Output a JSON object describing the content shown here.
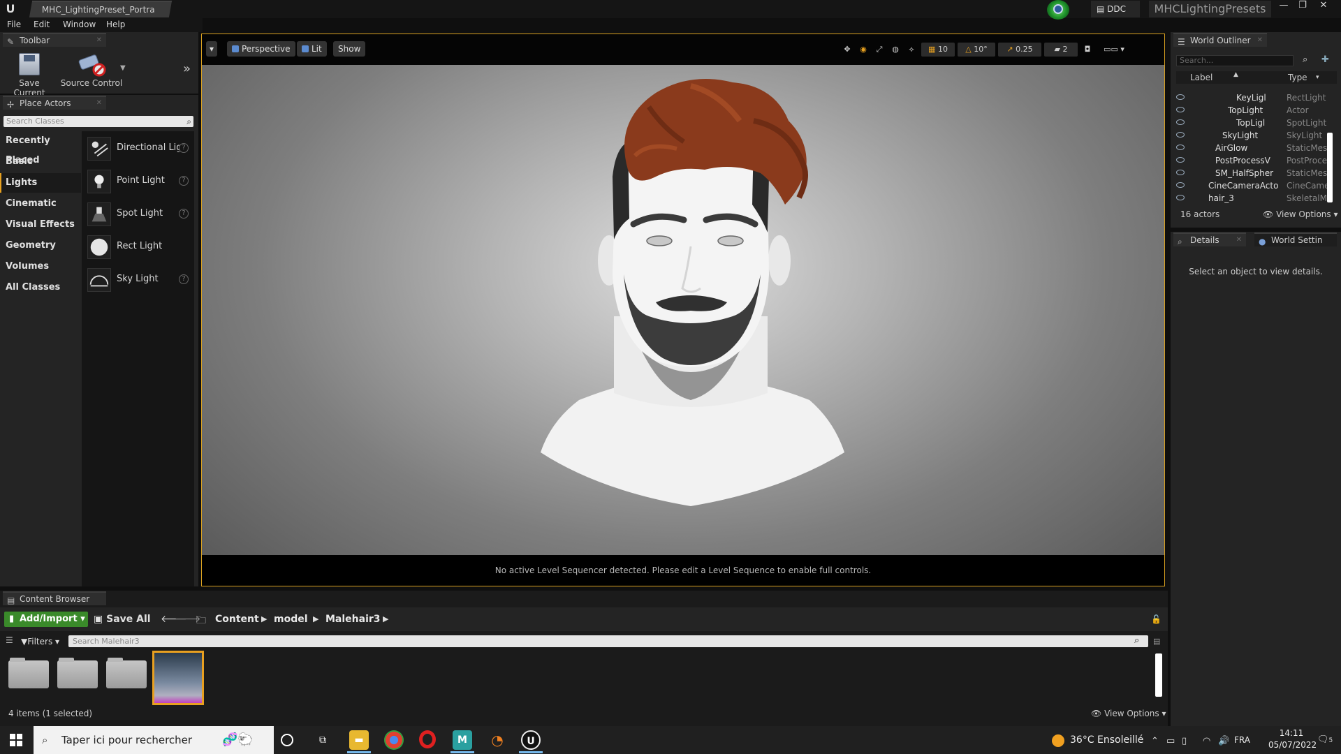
{
  "window": {
    "doc_tab": "MHC_LightingPreset_Portra",
    "ddc": "DDC",
    "project_name": "MHCLightingPresets"
  },
  "menu": [
    "File",
    "Edit",
    "Window",
    "Help"
  ],
  "toolbar": {
    "tab": "Toolbar",
    "save_current": "Save Current",
    "source_control": "Source Control"
  },
  "place_actors": {
    "tab": "Place Actors",
    "search_placeholder": "Search Classes",
    "categories": [
      "Recently Placed",
      "Basic",
      "Lights",
      "Cinematic",
      "Visual Effects",
      "Geometry",
      "Volumes",
      "All Classes"
    ],
    "selected_category": "Lights",
    "items": [
      "Directional Light",
      "Point Light",
      "Spot Light",
      "Rect Light",
      "Sky Light"
    ]
  },
  "viewport": {
    "perspective": "Perspective",
    "lit": "Lit",
    "show": "Show",
    "grid_snap": "10",
    "rotation_snap": "10°",
    "scale_snap": "0.25",
    "camera_speed": "2",
    "sequencer_message": "No active Level Sequencer detected. Please edit a Level Sequence to enable full controls."
  },
  "world_outliner": {
    "tab": "World Outliner",
    "search_placeholder": "Search...",
    "col_label": "Label",
    "col_type": "Type",
    "rows": [
      {
        "label": "KeyLigl",
        "type": "RectLight"
      },
      {
        "label": "TopLight",
        "type": "Actor"
      },
      {
        "label": "TopLigl",
        "type": "SpotLight"
      },
      {
        "label": "SkyLight",
        "type": "SkyLight"
      },
      {
        "label": "AirGlow",
        "type": "StaticMesh"
      },
      {
        "label": "PostProcessV",
        "type": "PostProce"
      },
      {
        "label": "SM_HalfSpher",
        "type": "StaticMesh"
      },
      {
        "label": "CineCameraActo",
        "type": "CineCame"
      },
      {
        "label": "hair_3",
        "type": "SkeletalMe"
      }
    ],
    "count": "16 actors",
    "view_options": "View Options"
  },
  "details": {
    "tab": "Details",
    "world_settings_tab": "World Settin",
    "empty_message": "Select an object to view details."
  },
  "content_browser": {
    "tab": "Content Browser",
    "add_import": "Add/Import",
    "save_all": "Save All",
    "breadcrumbs": [
      "Content",
      "model",
      "Malehair3"
    ],
    "filters": "Filters",
    "search_placeholder": "Search Malehair3",
    "status": "4 items (1 selected)",
    "view_options": "View Options"
  },
  "taskbar": {
    "search_placeholder": "Taper ici pour rechercher",
    "weather": "36°C  Ensoleillé",
    "language": "FRA",
    "time": "14:11",
    "date": "05/07/2022",
    "notifications": "5"
  },
  "colors": {
    "accent_orange": "#e6a020",
    "add_import_green": "#3a8a2a",
    "hair": "#8a3a1c"
  }
}
